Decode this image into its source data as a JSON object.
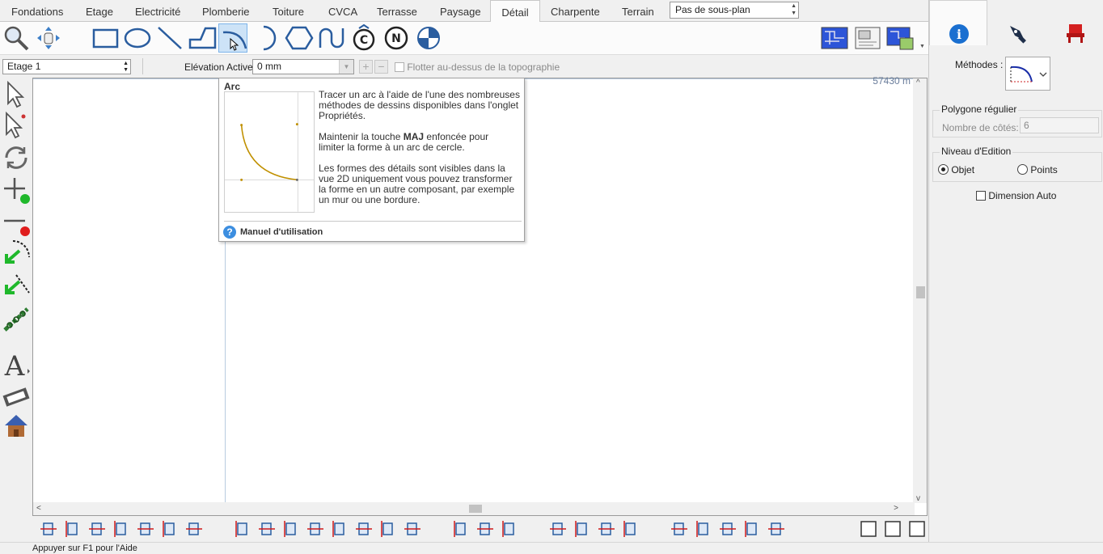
{
  "tabs": [
    {
      "label": "Fondations",
      "active": false
    },
    {
      "label": "Etage",
      "active": false
    },
    {
      "label": "Electricité",
      "active": false
    },
    {
      "label": "Plomberie",
      "active": false
    },
    {
      "label": "Toiture",
      "active": false
    },
    {
      "label": "CVCA",
      "active": false
    },
    {
      "label": "Terrasse",
      "active": false
    },
    {
      "label": "Paysage",
      "active": false
    },
    {
      "label": "Détail",
      "active": true
    },
    {
      "label": "Charpente",
      "active": false
    },
    {
      "label": "Terrain",
      "active": false
    }
  ],
  "subplan": {
    "value": "Pas de sous-plan"
  },
  "tools": {
    "selected": "arc-tool",
    "icons": [
      "zoom-icon",
      "pan-icon",
      "rectangle-icon",
      "ellipse-icon",
      "line-icon",
      "polyline-icon",
      "arc-icon",
      "half-circle-icon",
      "hexagon-icon",
      "u-shape-icon",
      "copyright-icon",
      "north-icon",
      "target-icon"
    ]
  },
  "options": {
    "floor": "Etage 1",
    "elevation_label": "Elévation Active:",
    "elevation_value": "0 mm",
    "float_label": "Flotter au-dessus de la topographie"
  },
  "canvas": {
    "dimension": "57430 m"
  },
  "tooltip": {
    "title": "Arc",
    "paragraphs": [
      "Tracer un arc à l'aide de l'une des nombreuses méthodes de dessins disponibles dans l'onglet Propriétés.",
      "limiter la forme à un arc de cercle.",
      "Les formes des détails sont visibles dans la vue 2D uniquement vous pouvez transformer la forme en un autre composant, par exemple un mur ou une bordure."
    ],
    "shift_prefix": "Maintenir la touche ",
    "shift_key": "MAJ",
    "shift_suffix": " enfoncée pour",
    "help_label": "Manuel d'utilisation"
  },
  "right_panel": {
    "tabs": [
      "info-icon",
      "pen-icon",
      "chair-icon"
    ],
    "methodes_label": "Méthodes :",
    "polygon": {
      "title": "Polygone régulier",
      "sides_label": "Nombre de côtés:",
      "sides_value": "6"
    },
    "edit_level": {
      "title": "Niveau d'Edition",
      "options": [
        "Objet",
        "Points"
      ],
      "selected": "Objet"
    },
    "auto_dimension": "Dimension Auto"
  },
  "status_bar": "Appuyer sur F1 pour l'Aide",
  "colors": {
    "accent": "#1a6fd0",
    "arc": "#c09000",
    "selected_bg": "#cde3f7"
  }
}
